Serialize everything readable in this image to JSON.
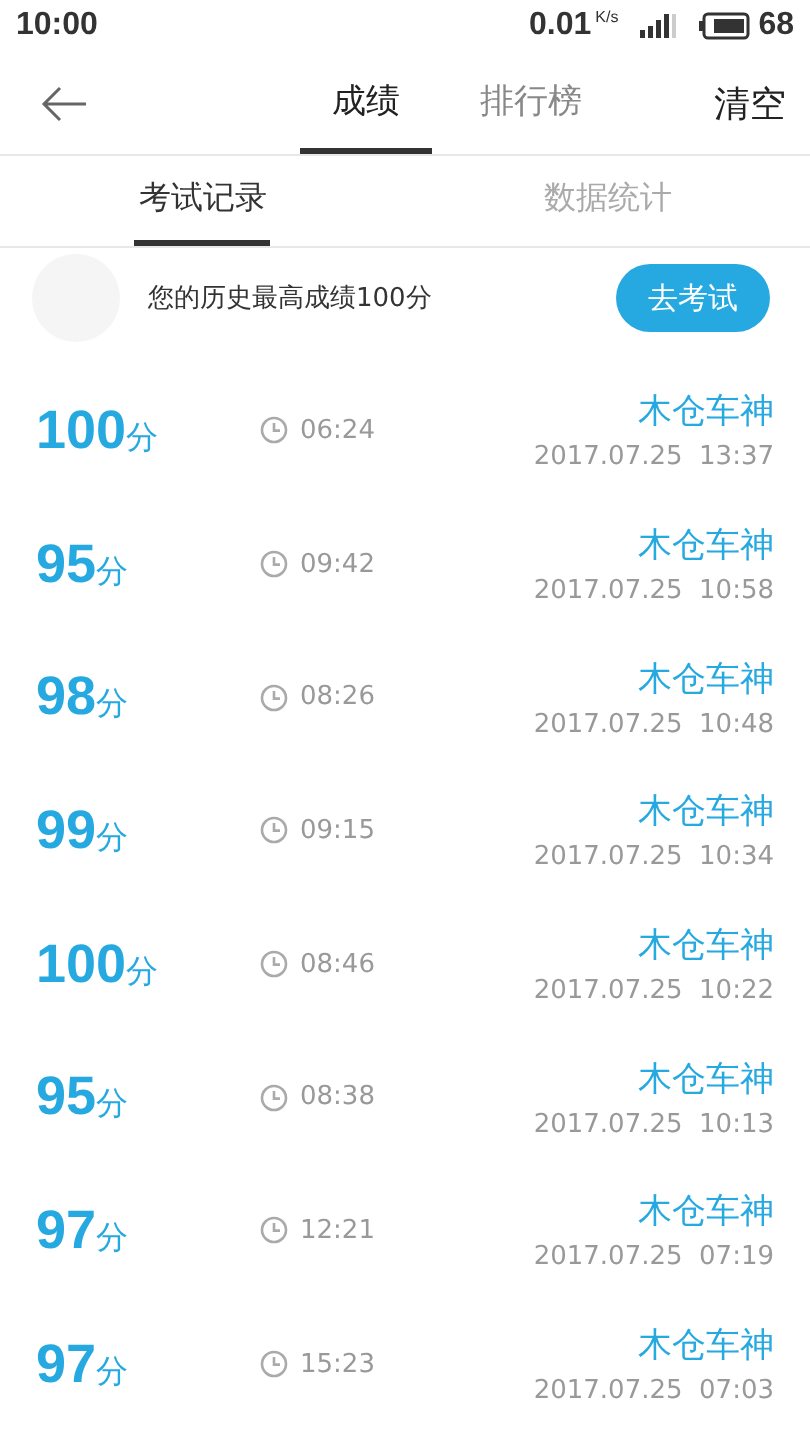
{
  "status_bar": {
    "time": "10:00",
    "speed": "0.01",
    "speed_unit": "K/s",
    "battery": "68"
  },
  "header": {
    "tabs": [
      {
        "label": "成绩",
        "selected": true
      },
      {
        "label": "排行榜",
        "selected": false
      }
    ],
    "action": "清空"
  },
  "sub_tabs": [
    {
      "label": "考试记录",
      "selected": true
    },
    {
      "label": "数据统计",
      "selected": false
    }
  ],
  "banner": {
    "text": "您的历史最高成绩100分",
    "button": "去考试"
  },
  "records": [
    {
      "score": "100",
      "unit": "分",
      "duration": "06:24",
      "name": "木仓车神",
      "date": "2017.07.25  13:37"
    },
    {
      "score": "95",
      "unit": "分",
      "duration": "09:42",
      "name": "木仓车神",
      "date": "2017.07.25  10:58"
    },
    {
      "score": "98",
      "unit": "分",
      "duration": "08:26",
      "name": "木仓车神",
      "date": "2017.07.25  10:48"
    },
    {
      "score": "99",
      "unit": "分",
      "duration": "09:15",
      "name": "木仓车神",
      "date": "2017.07.25  10:34"
    },
    {
      "score": "100",
      "unit": "分",
      "duration": "08:46",
      "name": "木仓车神",
      "date": "2017.07.25  10:22"
    },
    {
      "score": "95",
      "unit": "分",
      "duration": "08:38",
      "name": "木仓车神",
      "date": "2017.07.25  10:13"
    },
    {
      "score": "97",
      "unit": "分",
      "duration": "12:21",
      "name": "木仓车神",
      "date": "2017.07.25  07:19"
    },
    {
      "score": "97",
      "unit": "分",
      "duration": "15:23",
      "name": "木仓车神",
      "date": "2017.07.25  07:03"
    }
  ]
}
